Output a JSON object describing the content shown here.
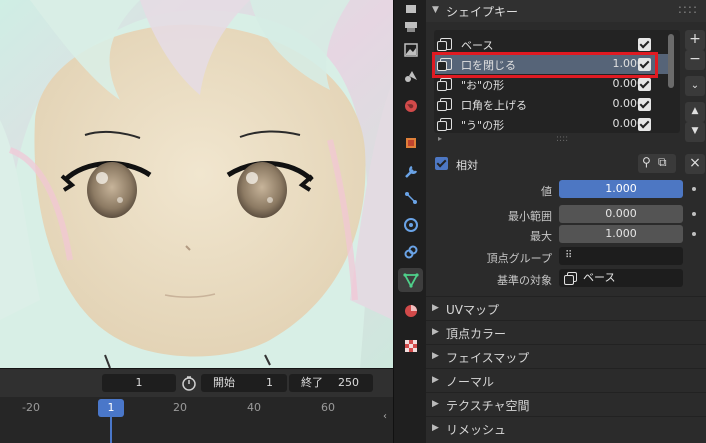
{
  "timeline": {
    "current_frame": "1",
    "start_label": "開始",
    "start_value": "1",
    "end_label": "終了",
    "end_value": "250",
    "ruler_ticks": [
      "-20",
      "1",
      "20",
      "40",
      "60"
    ]
  },
  "properties": {
    "panel_title": "シェイプキー",
    "shape_keys": [
      {
        "name": "ベース",
        "value": "",
        "checked": true
      },
      {
        "name": "口を閉じる",
        "value": "1.000",
        "checked": true
      },
      {
        "name": "\"お\"の形",
        "value": "0.000",
        "checked": true
      },
      {
        "name": "口角を上げる",
        "value": "0.000",
        "checked": true
      },
      {
        "name": "\"う\"の形",
        "value": "0.000",
        "checked": true
      }
    ],
    "relative_label": "相対",
    "value_label": "値",
    "value": "1.000",
    "min_label": "最小範囲",
    "min_value": "0.000",
    "max_label": "最大",
    "max_value": "1.000",
    "vertex_group_label": "頂点グループ",
    "vertex_group_value": "",
    "relative_to_label": "基準の対象",
    "relative_to_value": "ベース",
    "sections": [
      "UVマップ",
      "頂点カラー",
      "フェイスマップ",
      "ノーマル",
      "テクスチャ空間",
      "リメッシュ"
    ]
  },
  "colors": {
    "accent_blue": "#4d77c3",
    "highlight_red": "#e01a22",
    "selected_row": "#566478"
  },
  "icons": {
    "tabs": [
      "render-icon",
      "output-icon",
      "view-layer-icon",
      "scene-icon",
      "world-icon",
      "object-icon",
      "modifier-icon",
      "particles-icon",
      "physics-icon",
      "constraints-icon",
      "object-data-icon",
      "material-icon",
      "texture-icon"
    ]
  }
}
